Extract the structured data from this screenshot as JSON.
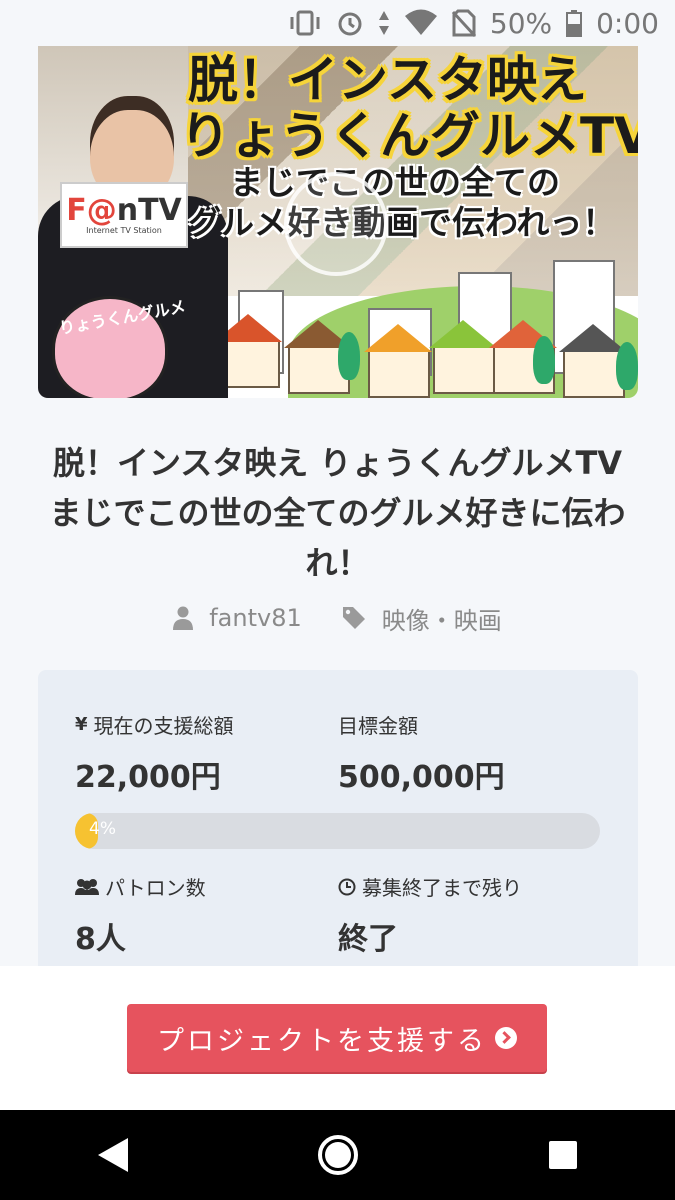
{
  "status_bar": {
    "battery": "50%",
    "time": "0:00",
    "icons": [
      "vibrate-icon",
      "alarm-icon",
      "data-icon",
      "wifi-icon",
      "no-sim-icon",
      "battery-icon"
    ]
  },
  "hero": {
    "title_line1": "脱！インスタ映え",
    "title_line2": "りょうくんグルメTV",
    "sub_line1": "まじでこの世の全ての",
    "sub_line2": "グルメ好き動画で伝われっ！",
    "sign_logo_a": "F",
    "sign_logo_at": "@",
    "sign_logo_b": "nTV",
    "sign_tagline": "Internet TV Station",
    "mascot_text": "りょうくんグルメ"
  },
  "project": {
    "title": "脱！インスタ映え りょうくんグルメTV　まじでこの世の全てのグルメ好きに伝われ！",
    "owner": "fantv81",
    "category": "映像・映画"
  },
  "stats": {
    "current_label": "現在の支援総額",
    "current_value": "22,000円",
    "goal_label": "目標金額",
    "goal_value": "500,000円",
    "progress_text": "4%",
    "progress_fraction": 0.044,
    "patrons_label": "パトロン数",
    "patrons_value": "8人",
    "remaining_label": "募集終了まで残り",
    "remaining_value": "終了"
  },
  "cta": {
    "label": "プロジェクトを支援する"
  },
  "colors": {
    "accent": "#e6535e",
    "progress": "#f6c231",
    "card": "#e9eef5"
  }
}
